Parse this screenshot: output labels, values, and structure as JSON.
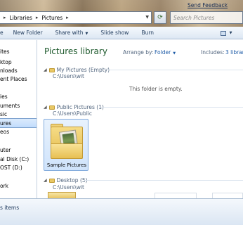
{
  "window": {
    "send_feedback": "Send Feedback"
  },
  "address": {
    "crumbs": [
      "Libraries",
      "Pictures"
    ]
  },
  "search": {
    "placeholder": "Search Pictures"
  },
  "toolbar": {
    "items": [
      "e",
      "New Folder",
      "Share with",
      "Slide show",
      "Burn"
    ]
  },
  "nav": {
    "items": [
      "ites",
      "ktop",
      "nloads",
      "ent Places",
      "ies",
      "uments",
      "sic",
      "ures",
      "eos",
      "uter",
      "al Disk (C:)",
      "OST (D:)",
      "ork"
    ],
    "selected": "ures"
  },
  "library": {
    "title": "Pictures library",
    "arrange_label": "Arrange by:",
    "arrange_value": "Folder",
    "includes_label": "Includes:",
    "includes_value": "3 library"
  },
  "groups": [
    {
      "name": "My Pictures (Empty)",
      "path": "C:\\Users\\wit",
      "empty_message": "This folder is empty."
    },
    {
      "name": "Public Pictures (1)",
      "path": "C:\\Users\\Public",
      "items": [
        "Sample Pictures"
      ]
    },
    {
      "name": "Desktop (5)",
      "path": "C:\\Users\\wit"
    }
  ],
  "status": {
    "text": "s items"
  }
}
